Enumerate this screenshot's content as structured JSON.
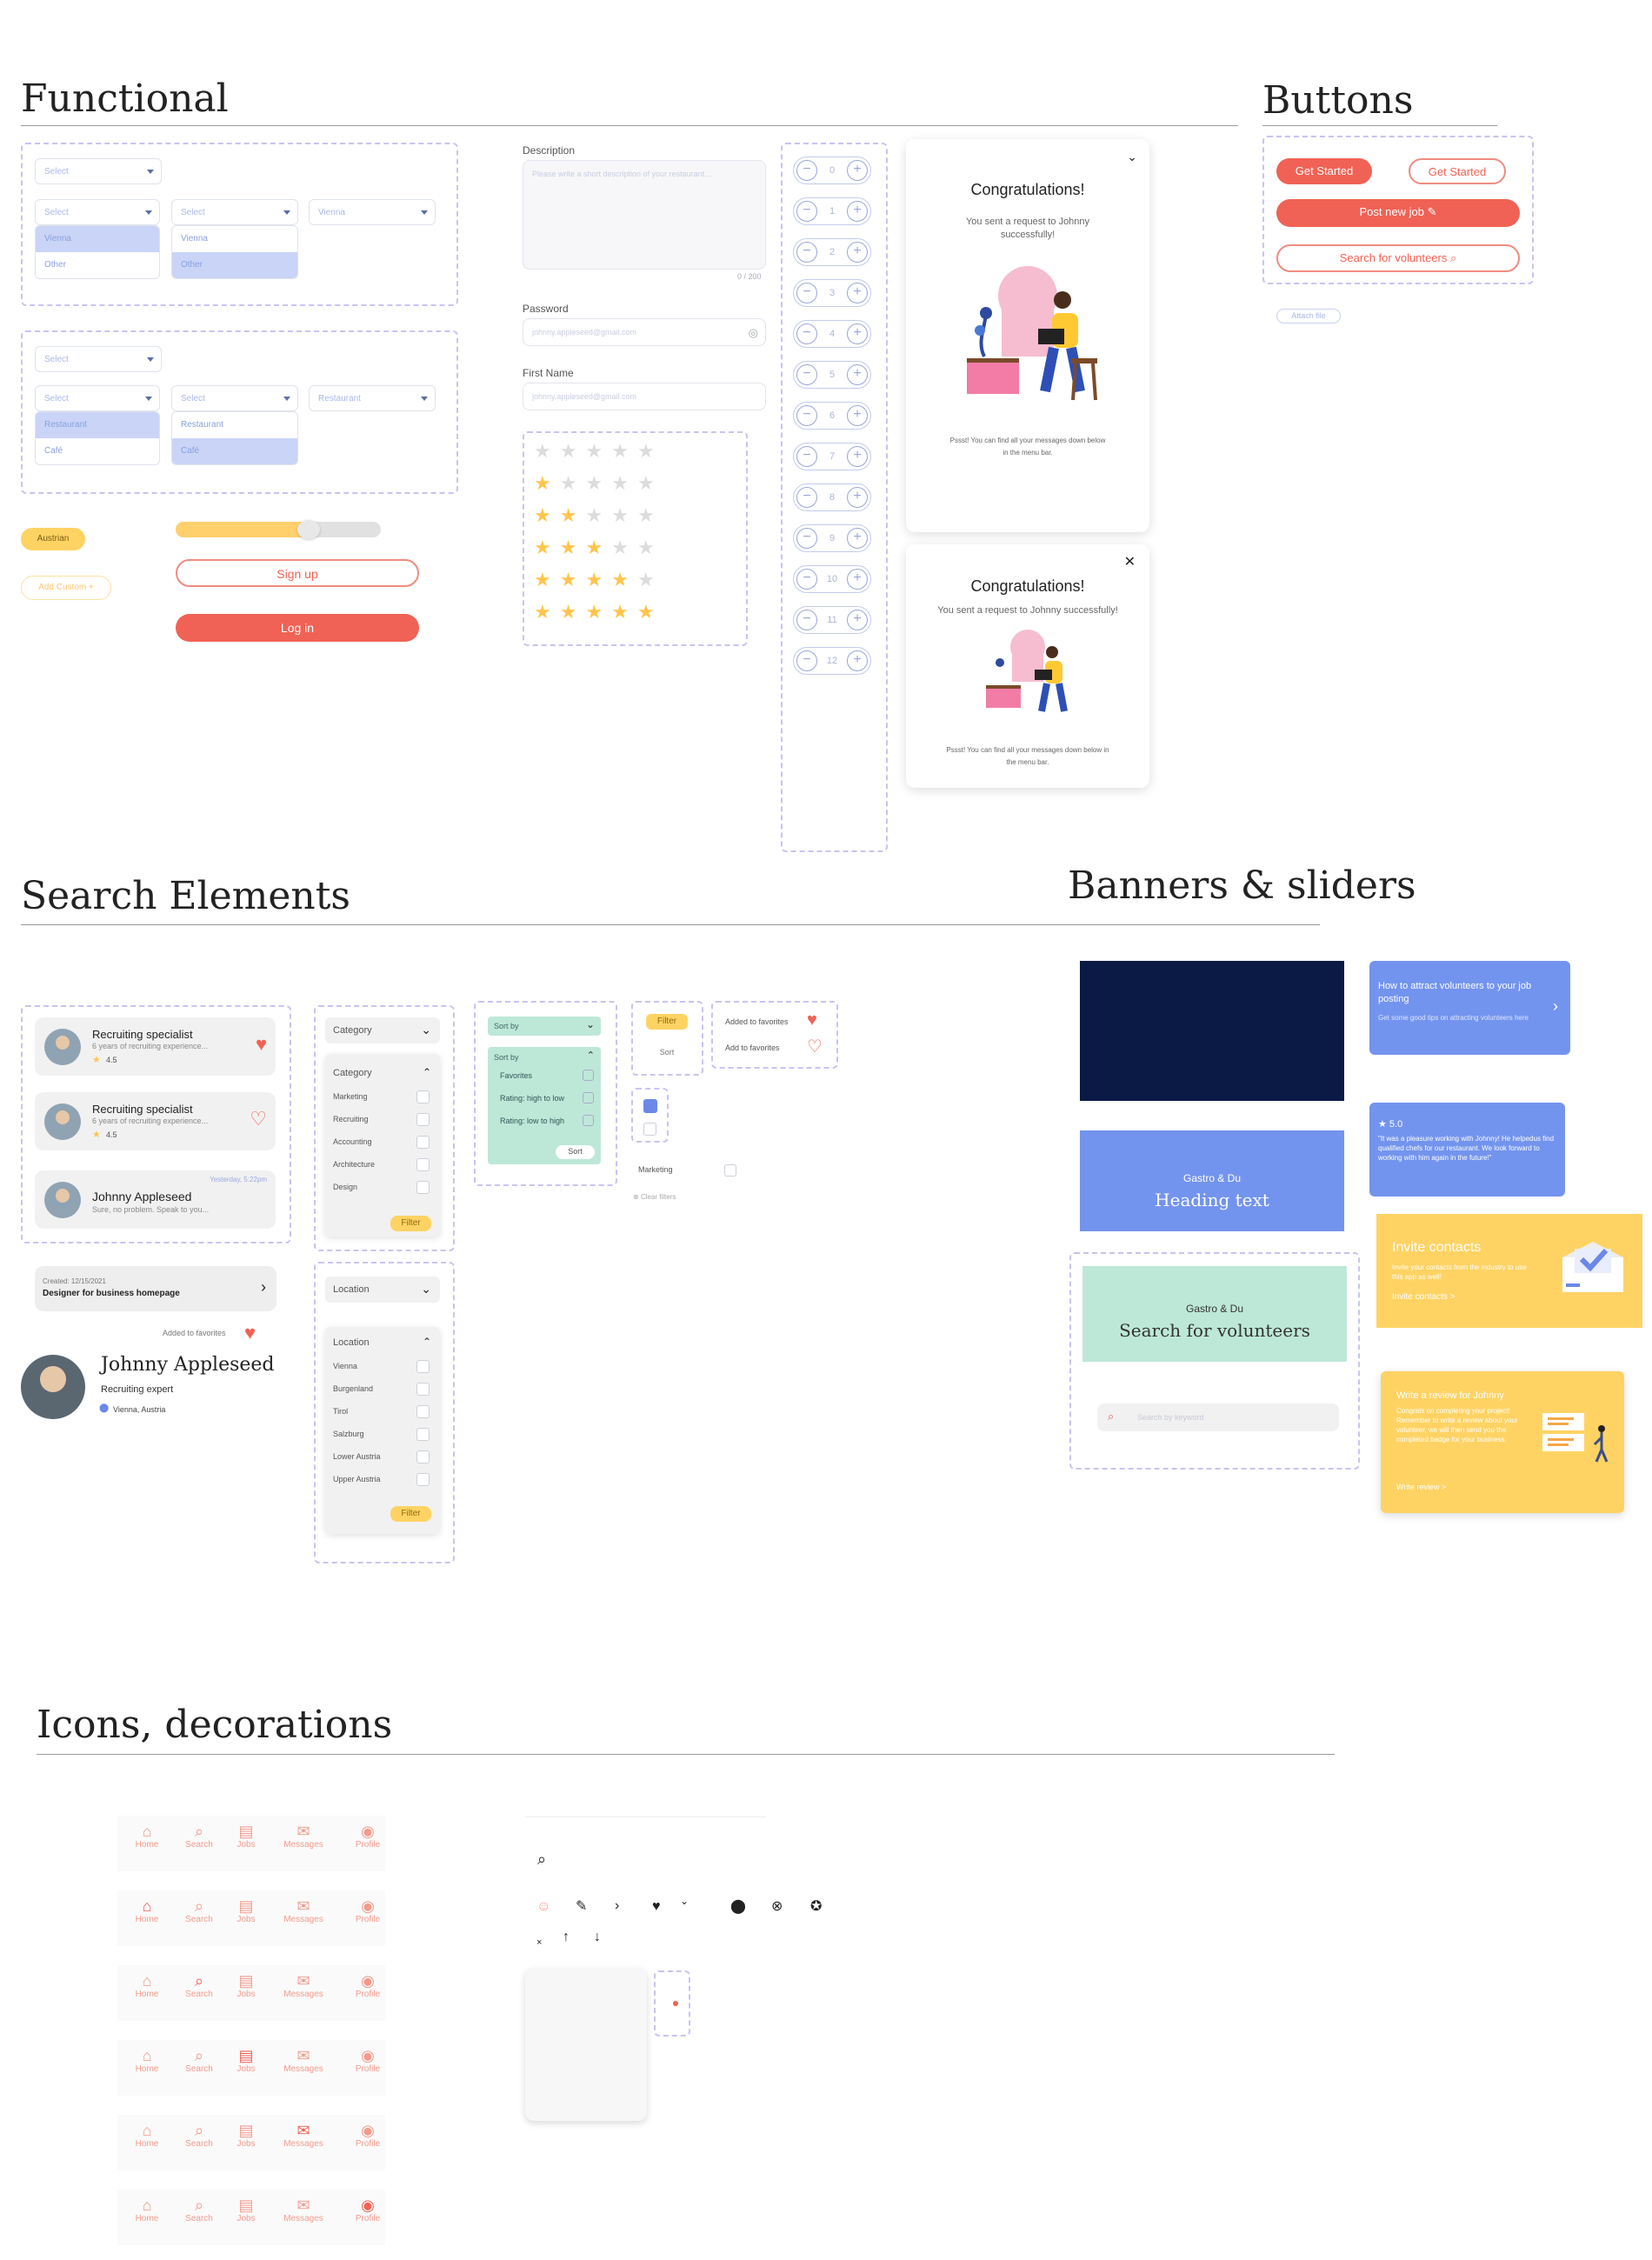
{
  "sections": {
    "functional": "Functional",
    "buttons": "Buttons",
    "search": "Search Elements",
    "banners": "Banners & sliders",
    "icons": "Icons, decorations"
  },
  "selects": {
    "placeholder": "Select",
    "vienna": "Vienna",
    "other": "Other",
    "restaurant": "Restaurant",
    "cafe": "Café"
  },
  "tags": {
    "austrian": "Austrian",
    "add_custom": "Add Custom +"
  },
  "progress": {
    "value": 0.65
  },
  "auth": {
    "signup": "Sign up",
    "login": "Log in"
  },
  "form": {
    "description_label": "Description",
    "description_placeholder": "Please write a short description of your restaurant...",
    "description_counter": "0 / 200",
    "password_label": "Password",
    "password_value": "johnny.appleseed@gmail.com",
    "firstname_label": "First Name",
    "firstname_value": "johnny.appleseed@gmail.com"
  },
  "ratings": [
    0,
    1,
    2,
    3,
    4,
    5
  ],
  "steppers": [
    "0",
    "1",
    "2",
    "3",
    "4",
    "5",
    "6",
    "7",
    "8",
    "9",
    "10",
    "11",
    "12"
  ],
  "modal": {
    "title": "Congratulations!",
    "text": "You sent a request to Johnny successfully!",
    "text2": "You sent a request to Johnny successfully!",
    "footer": "Pssst! You can find all your messages down below in the menu bar."
  },
  "btns": {
    "get_started": "Get Started",
    "get_started_outline": "Get Started",
    "post_job": "Post new job",
    "search_volunteers": "Search for volunteers",
    "attach": "Attach file"
  },
  "results": [
    {
      "title": "Recruiting specialist",
      "desc": "6 years of recruiting experience...",
      "rating": "4.5",
      "fav": true
    },
    {
      "title": "Recruiting specialist",
      "desc": "6 years of recruiting experience...",
      "rating": "4.5",
      "fav": false
    }
  ],
  "message": {
    "name": "Johnny Appleseed",
    "time": "Yesterday, 5:22pm",
    "text": "Sure, no problem. Speak to you..."
  },
  "job": {
    "created": "Created: 12/15/2021",
    "title": "Designer for business homepage"
  },
  "profile": {
    "fav_label": "Added to favorites",
    "name": "Johnny Appleseed",
    "role": "Recruiting expert",
    "location": "Vienna, Austria"
  },
  "category": {
    "label": "Category",
    "items": [
      "Marketing",
      "Recruiting",
      "Accounting",
      "Architecture",
      "Design"
    ],
    "filter": "Filter"
  },
  "location": {
    "label": "Location",
    "items": [
      "Vienna",
      "Burgenland",
      "Tirol",
      "Salzburg",
      "Lower Austria",
      "Upper Austria"
    ],
    "filter": "Filter"
  },
  "sort": {
    "label": "Sort by",
    "items": [
      "Favorites",
      "Rating: high to low",
      "Rating: low to high"
    ],
    "button": "Sort"
  },
  "misc": {
    "filter": "Filter",
    "sort": "Sort",
    "fav_added": "Added to favorites",
    "fav_add": "Add to favorites",
    "marketing": "Marketing",
    "clear": "Clear filters"
  },
  "banners": {
    "blue_card": {
      "title": "How to attract volunteers to your job posting",
      "text": "Get some good tips on attracting volunteers here"
    },
    "review": {
      "rating": "★ 5.0",
      "text": "\"It was a pleasure working with Johnny! He helpedus find qualified chefs for our restaurant. We look forward to working with him again in the future!\""
    },
    "heading": {
      "sub": "Gastro & Du",
      "title": "Heading text"
    },
    "invite": {
      "title": "Invite contacts",
      "text": "Invite your contacts from the industry to use this app as well!",
      "link": "Invite contacts >"
    },
    "volunteers": {
      "sub": "Gastro & Du",
      "title": "Search for volunteers",
      "search": "Search by keyword"
    },
    "write_review": {
      "title": "Write a review for Johnny",
      "text": "Congrats on completing your project! Remember to write a review about your volunteer, we will then send you the completed badge for your business.",
      "link": "Write review >"
    }
  },
  "nav": {
    "items": [
      "Home",
      "Search",
      "Jobs",
      "Messages",
      "Profile"
    ],
    "active": [
      -1,
      0,
      1,
      2,
      3,
      4
    ]
  },
  "colors": {
    "coral": "#f06255",
    "yellow": "#ffd363",
    "blue": "#7394ee",
    "navy": "#0b1a44",
    "mint": "#bde8d8",
    "purple_dash": "#c8c4f2"
  }
}
